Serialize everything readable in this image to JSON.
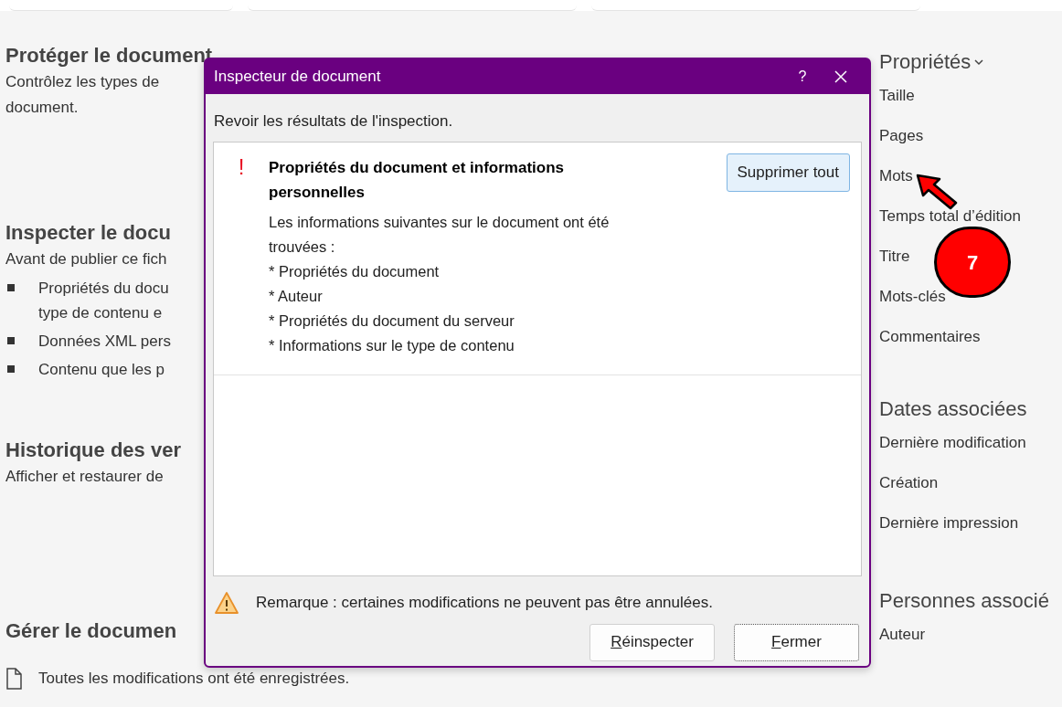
{
  "page": {
    "left_sections": [
      {
        "heading": "Protéger le document",
        "lines": [
          "Contrôlez les types de",
          "document."
        ]
      },
      {
        "heading": "Inspecter le docu",
        "lines": [
          "Avant de publier ce fich"
        ],
        "bullets": [
          [
            "Propriétés du docu",
            "type de contenu e"
          ],
          [
            "Données XML pers"
          ],
          [
            "Contenu que les p"
          ]
        ]
      },
      {
        "heading": "Historique des ver",
        "lines": [
          "Afficher et restaurer de"
        ]
      },
      {
        "heading": "Gérer le documen"
      }
    ],
    "save_status": "Toutes les modifications ont été enregistrées.",
    "right_sections": [
      {
        "heading": "Propriétés",
        "dropdown": true,
        "items": [
          "Taille",
          "Pages",
          "Mots",
          "Temps total d’édition",
          "Titre",
          "Mots-clés",
          "Commentaires"
        ]
      },
      {
        "heading": "Dates associées",
        "dropdown": false,
        "items": [
          "Dernière modification",
          "Création",
          "Dernière impression"
        ]
      },
      {
        "heading": "Personnes associé",
        "dropdown": false,
        "items": [
          "Auteur"
        ]
      }
    ]
  },
  "dialog": {
    "title": "Inspecteur de document",
    "help": "?",
    "intro": "Revoir les résultats de l'inspection.",
    "results": [
      {
        "mark": "!",
        "title": "Propriétés du document et informations personnelles",
        "lines": [
          "Les informations suivantes sur le document ont été trouvées :",
          "* Propriétés du document",
          "* Auteur",
          "* Propriétés du document du serveur",
          "* Informations sur le type de contenu"
        ],
        "action": "Supprimer tout"
      }
    ],
    "note": "Remarque : certaines modifications ne peuvent pas être annulées.",
    "buttons": [
      {
        "label": "Réinspecter",
        "underlined_first_letter": true,
        "focused": false
      },
      {
        "label": "Fermer",
        "underlined_first_letter": true,
        "focused": true
      }
    ]
  },
  "annotation": {
    "number": "7"
  }
}
